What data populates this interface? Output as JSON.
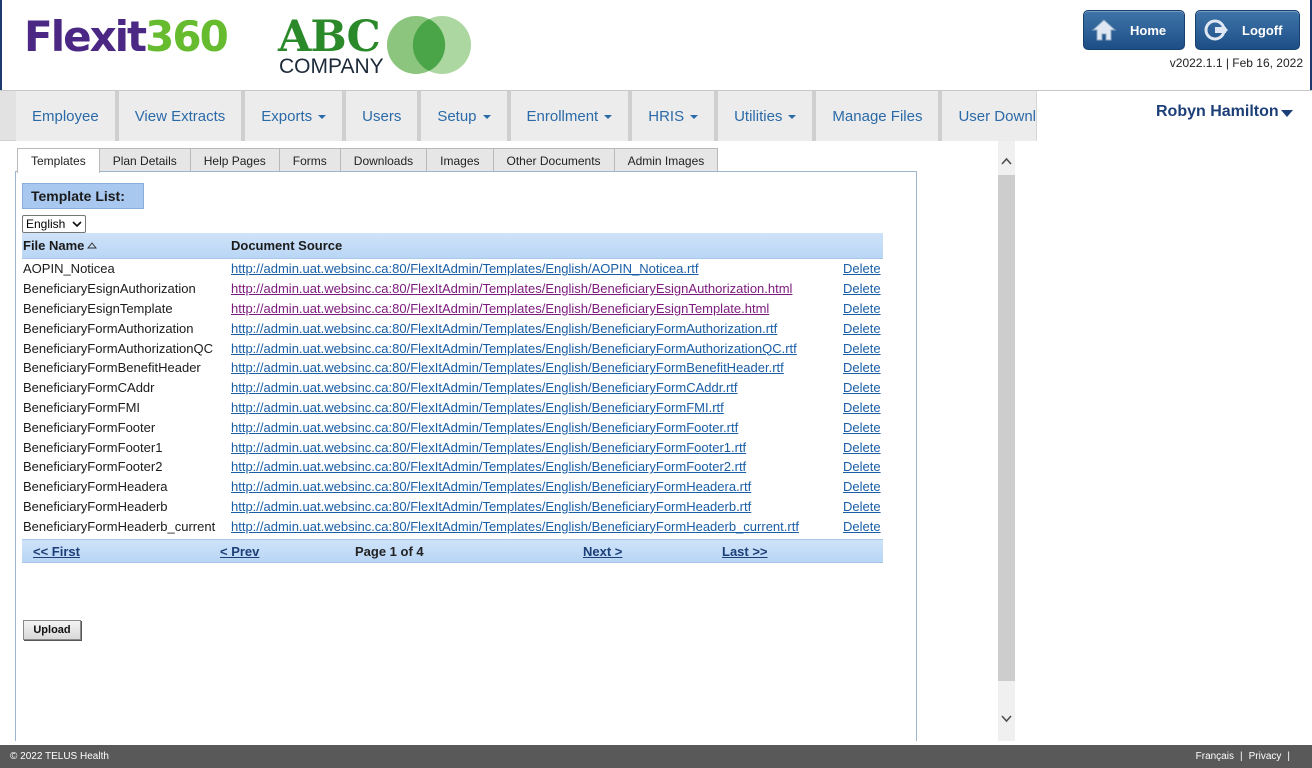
{
  "header": {
    "brand_flex": "Flexit",
    "brand_360": "360",
    "client_name": "ABC",
    "client_sub": "COMPANY",
    "home_label": "Home",
    "logoff_label": "Logoff",
    "version": "v2022.1.1 | Feb 16, 2022"
  },
  "nav": {
    "items": [
      {
        "label": "Employee"
      },
      {
        "label": "View Extracts"
      },
      {
        "label": "Exports"
      },
      {
        "label": "Users"
      },
      {
        "label": "Setup"
      },
      {
        "label": "Enrollment"
      },
      {
        "label": "HRIS"
      },
      {
        "label": "Utilities"
      },
      {
        "label": "Manage Files"
      },
      {
        "label": "User Downloads"
      }
    ],
    "user_name": "Robyn Hamilton"
  },
  "tabs": [
    "Templates",
    "Plan Details",
    "Help Pages",
    "Forms",
    "Downloads",
    "Images",
    "Other Documents",
    "Admin Images"
  ],
  "main": {
    "section_title": "Template List:",
    "language": "English",
    "columns": [
      "File Name",
      "Document Source"
    ],
    "delete_label": "Delete",
    "rows": [
      {
        "name": "AOPIN_Noticea",
        "src": "http://admin.uat.websinc.ca:80/FlexItAdmin/Templates/English/AOPIN_Noticea.rtf"
      },
      {
        "name": "BeneficiaryEsignAuthorization",
        "src": "http://admin.uat.websinc.ca:80/FlexItAdmin/Templates/English/BeneficiaryEsignAuthorization.html"
      },
      {
        "name": "BeneficiaryEsignTemplate",
        "src": "http://admin.uat.websinc.ca:80/FlexItAdmin/Templates/English/BeneficiaryEsignTemplate.html"
      },
      {
        "name": "BeneficiaryFormAuthorization",
        "src": "http://admin.uat.websinc.ca:80/FlexItAdmin/Templates/English/BeneficiaryFormAuthorization.rtf"
      },
      {
        "name": "BeneficiaryFormAuthorizationQC",
        "src": "http://admin.uat.websinc.ca:80/FlexItAdmin/Templates/English/BeneficiaryFormAuthorizationQC.rtf"
      },
      {
        "name": "BeneficiaryFormBenefitHeader",
        "src": "http://admin.uat.websinc.ca:80/FlexItAdmin/Templates/English/BeneficiaryFormBenefitHeader.rtf"
      },
      {
        "name": "BeneficiaryFormCAddr",
        "src": "http://admin.uat.websinc.ca:80/FlexItAdmin/Templates/English/BeneficiaryFormCAddr.rtf"
      },
      {
        "name": "BeneficiaryFormFMI",
        "src": "http://admin.uat.websinc.ca:80/FlexItAdmin/Templates/English/BeneficiaryFormFMI.rtf"
      },
      {
        "name": "BeneficiaryFormFooter",
        "src": "http://admin.uat.websinc.ca:80/FlexItAdmin/Templates/English/BeneficiaryFormFooter.rtf"
      },
      {
        "name": "BeneficiaryFormFooter1",
        "src": "http://admin.uat.websinc.ca:80/FlexItAdmin/Templates/English/BeneficiaryFormFooter1.rtf"
      },
      {
        "name": "BeneficiaryFormFooter2",
        "src": "http://admin.uat.websinc.ca:80/FlexItAdmin/Templates/English/BeneficiaryFormFooter2.rtf"
      },
      {
        "name": "BeneficiaryFormHeadera",
        "src": "http://admin.uat.websinc.ca:80/FlexItAdmin/Templates/English/BeneficiaryFormHeadera.rtf"
      },
      {
        "name": "BeneficiaryFormHeaderb",
        "src": "http://admin.uat.websinc.ca:80/FlexItAdmin/Templates/English/BeneficiaryFormHeaderb.rtf"
      },
      {
        "name": "BeneficiaryFormHeaderb_current",
        "src": "http://admin.uat.websinc.ca:80/FlexItAdmin/Templates/English/BeneficiaryFormHeaderb_current.rtf"
      }
    ],
    "pager": {
      "first": "<< First",
      "prev": "< Prev",
      "info": "Page 1 of 4",
      "next": "Next >",
      "last": "Last >>"
    },
    "upload_label": "Upload"
  },
  "footer": {
    "copyright": "© 2022 TELUS Health",
    "francais": "Français",
    "privacy": "Privacy"
  },
  "colors": {
    "brand_purple": "#4b2884",
    "brand_green": "#66bb2e",
    "button_blue": "#2b5f96",
    "link_blue": "#1a5ea6",
    "visited_link": "#7d1a7d"
  }
}
